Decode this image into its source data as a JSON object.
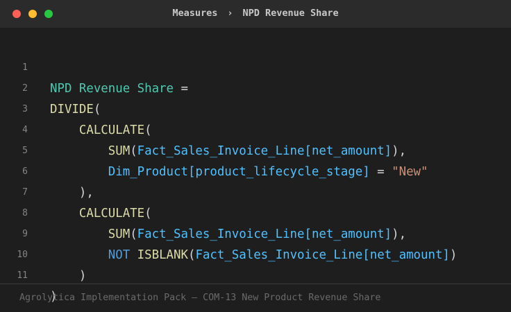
{
  "titlebar": {
    "breadcrumb_parent": "Measures",
    "breadcrumb_separator": "›",
    "breadcrumb_current": "NPD Revenue Share"
  },
  "editor": {
    "line_numbers": [
      "1",
      "2",
      "3",
      "4",
      "5",
      "6",
      "7",
      "8",
      "9",
      "10",
      "11"
    ],
    "tokens": {
      "l1_measure": "NPD Revenue Share",
      "l1_eq": " =",
      "l2_fn": "DIVIDE",
      "l2_paren": "(",
      "l3_indent": "    ",
      "l3_fn": "CALCULATE",
      "l3_paren": "(",
      "l4_indent": "        ",
      "l4_fn": "SUM",
      "l4_open": "(",
      "l4_table": "Fact_Sales_Invoice_Line",
      "l4_col": "[net_amount]",
      "l4_close": "),",
      "l5_indent": "        ",
      "l5_table": "Dim_Product",
      "l5_col": "[product_lifecycle_stage]",
      "l5_eq": " = ",
      "l5_str": "\"New\"",
      "l6_text": "    ),",
      "l7_indent": "    ",
      "l7_fn": "CALCULATE",
      "l7_paren": "(",
      "l8_indent": "        ",
      "l8_fn": "SUM",
      "l8_open": "(",
      "l8_table": "Fact_Sales_Invoice_Line",
      "l8_col": "[net_amount]",
      "l8_close": "),",
      "l9_indent": "        ",
      "l9_kw": "NOT",
      "l9_space": " ",
      "l9_fn": "ISBLANK",
      "l9_open": "(",
      "l9_table": "Fact_Sales_Invoice_Line",
      "l9_col": "[net_amount]",
      "l9_close": ")",
      "l10_text": "    )",
      "l11_text": ")"
    }
  },
  "footer": {
    "text": "Agrolytica Implementation Pack — COM-13 New Product Revenue Share"
  },
  "colors": {
    "background": "#1e1e1e",
    "titlebar": "#2b2b2b",
    "measure": "#4ec9b0",
    "function": "#dcdcaa",
    "table": "#4fc1ff",
    "keyword": "#569cd6",
    "string": "#ce9178"
  }
}
